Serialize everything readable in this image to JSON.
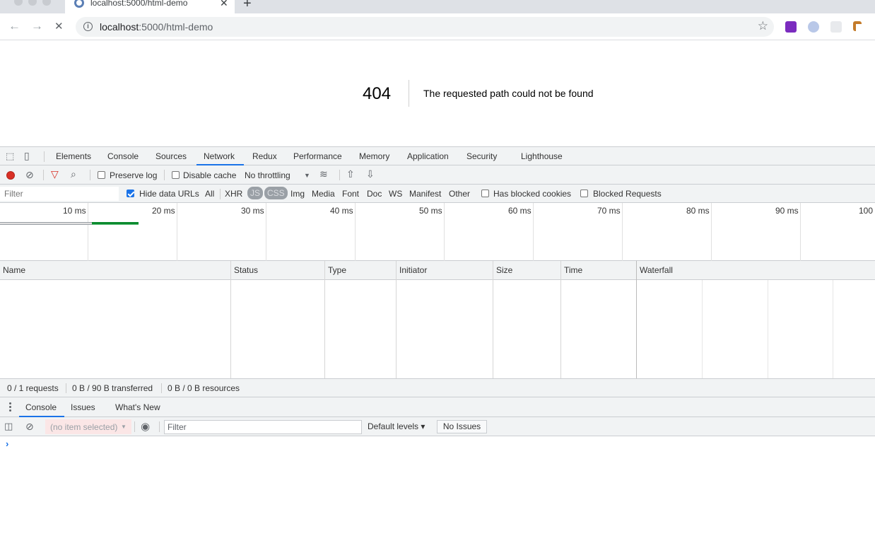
{
  "browser": {
    "tab_title": "localhost:5000/html-demo",
    "url_host": "localhost",
    "url_path": ":5000/html-demo",
    "icons": [
      "back-icon",
      "forward-icon",
      "stop-icon",
      "info-icon",
      "star-icon",
      "new-tab-icon",
      "close-icon"
    ]
  },
  "page": {
    "error_code": "404",
    "error_message": "The requested path could not be found"
  },
  "devtools": {
    "tabs": [
      "Elements",
      "Console",
      "Sources",
      "Network",
      "Redux",
      "Performance",
      "Memory",
      "Application",
      "Security",
      "Lighthouse"
    ],
    "active_tab": "Network",
    "network_toolbar": {
      "preserve_log": "Preserve log",
      "disable_cache": "Disable cache",
      "throttling": "No throttling"
    },
    "filter_bar": {
      "filter_placeholder": "Filter",
      "hide_data_urls": "Hide data URLs",
      "types": [
        "All",
        "XHR",
        "JS",
        "CSS",
        "Img",
        "Media",
        "Font",
        "Doc",
        "WS",
        "Manifest",
        "Other"
      ],
      "has_blocked_cookies": "Has blocked cookies",
      "blocked_requests": "Blocked Requests"
    },
    "overview_ticks": [
      "10 ms",
      "20 ms",
      "30 ms",
      "40 ms",
      "50 ms",
      "60 ms",
      "70 ms",
      "80 ms",
      "90 ms",
      "100"
    ],
    "columns": [
      "Name",
      "Status",
      "Type",
      "Initiator",
      "Size",
      "Time",
      "Waterfall"
    ],
    "summary": {
      "requests": "0 / 1 requests",
      "transferred": "0 B / 90 B transferred",
      "resources": "0 B / 0 B resources"
    },
    "drawer": {
      "tabs": [
        "Console",
        "Issues",
        "What's New"
      ],
      "context": "(no item selected)",
      "filter_placeholder": "Filter",
      "levels": "Default levels ▾",
      "issues": "No Issues"
    },
    "accent": "#1a73e8",
    "record_color": "#d93025"
  }
}
